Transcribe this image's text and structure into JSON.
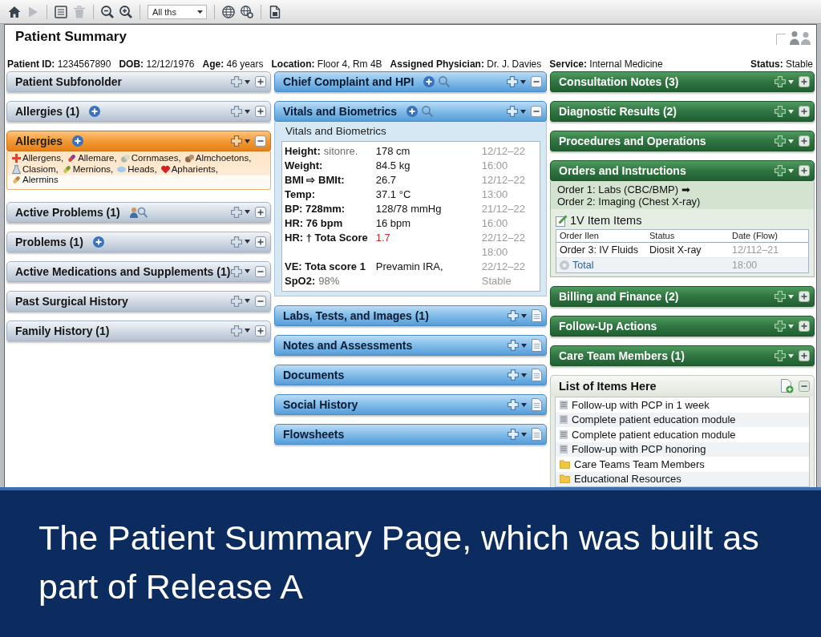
{
  "toolbar": {
    "buttons": [
      {
        "disabled": false
      },
      {
        "disabled": true
      },
      {
        "disabled": false
      },
      {
        "disabled": true
      },
      {
        "disabled": false
      },
      {
        "disabled": false
      }
    ],
    "filter": {
      "value": "All ths"
    },
    "more_buttons": [
      {
        "disabled": false
      },
      {
        "disabled": false
      },
      {
        "disabled": false
      }
    ]
  },
  "window": {
    "title": "Patient Summary"
  },
  "patient": {
    "fields": [
      {
        "label": "Patient ID:",
        "value": "1234567890"
      },
      {
        "label": "DOB:",
        "value": "12/12/1976"
      },
      {
        "label": "Age:",
        "value": "46 years"
      },
      {
        "label": "Location:",
        "value": "Floor 4, Rm 4B"
      },
      {
        "label": "Assigned Physician:",
        "value": "Dr. J. Davies"
      },
      {
        "label": "Service:",
        "value": "Internal Medicine"
      }
    ],
    "status": {
      "label": "Status:",
      "value": "Stable"
    }
  },
  "columns": [
    {
      "panels": [
        {
          "kind": "bar",
          "title": "Patient Subfonolder",
          "selected": false,
          "expanded": false
        },
        {
          "kind": "bar",
          "title": "Allergies (1)",
          "selected": false,
          "expanded": false,
          "header_icons": [
            {
              "kind": "add"
            }
          ]
        },
        {
          "kind": "allergies",
          "title": "Allergies",
          "selected": true,
          "expanded": true,
          "header_icons": [
            {
              "kind": "add"
            }
          ],
          "items": [
            "Allergens,",
            "Allemare,",
            "Cornmases,",
            "Almchoetons,",
            "Clasiom,",
            "Mernions,",
            "Heads,",
            "Apharients,",
            "Alermins"
          ]
        },
        {
          "kind": "bar",
          "title": "Active Problems (1)",
          "selected": false,
          "expanded": false,
          "header_icons": [
            {
              "kind": "people_search"
            }
          ]
        },
        {
          "kind": "bar",
          "title": "Problems (1)",
          "selected": false,
          "expanded": false,
          "header_icons": [
            {
              "kind": "add"
            }
          ]
        },
        {
          "kind": "bar",
          "title": "Active Medications and Supplements (1)",
          "selected": false,
          "expanded": true
        },
        {
          "kind": "bar",
          "title": "Past Surgical History",
          "selected": false,
          "expanded": true
        },
        {
          "kind": "bar",
          "title": "Family History (1)",
          "selected": false,
          "expanded": false
        }
      ]
    },
    {
      "panels": [
        {
          "kind": "bar",
          "title": "Chief Complaint and HPI",
          "selected": false,
          "expanded": true,
          "header_icons": [
            {
              "kind": "add"
            },
            {
              "kind": "search"
            }
          ]
        },
        {
          "kind": "vitals",
          "title": "Vitals and Biometrics",
          "selected": false,
          "expanded": true,
          "header_icons": [
            {
              "kind": "add"
            },
            {
              "kind": "search"
            }
          ],
          "subtitle": "Vitals and Biometrics",
          "rows": [
            {
              "label": "Height:",
              "note": "sitonre.",
              "value": "178 cm",
              "time": "12/12–22",
              "flagged": false
            },
            {
              "label": "Weight:",
              "value": "84.5 kg",
              "time": "16:00",
              "flagged": false
            },
            {
              "label": "BMI ⇨ BMIt:",
              "value": "26.7",
              "time": "12/12–22",
              "flagged": false
            },
            {
              "label": "Temp:",
              "value": "37.1 °C",
              "time": "13:00",
              "flagged": false
            },
            {
              "label": "BP: 728mm:",
              "value": "128/78 mmHg",
              "time": "21/12–22",
              "flagged": false
            },
            {
              "label": "HR: 76 bpm",
              "value": "16 bpm",
              "time": "16:00",
              "flagged": false
            },
            {
              "label": "HR: † Tota Score",
              "value": "1.7",
              "time": "22/12–22",
              "flagged": true
            },
            {
              "time": "18:00"
            },
            {
              "label": "VE: Tota score 1",
              "value": "Prevamin IRA,",
              "time": "22/12–22",
              "flagged": false
            },
            {
              "label": "SpO2:",
              "note": "98%",
              "time": "Stable"
            }
          ]
        },
        {
          "kind": "page_bar",
          "title": "Labs, Tests, and Images (1)",
          "selected": false
        },
        {
          "kind": "page_bar",
          "title": "Notes and Assessments",
          "selected": false
        },
        {
          "kind": "page_bar",
          "title": "Documents",
          "selected": false
        },
        {
          "kind": "page_bar",
          "title": "Social History",
          "selected": false
        },
        {
          "kind": "page_bar",
          "title": "Flowsheets",
          "selected": false
        }
      ]
    },
    {
      "panels": [
        {
          "kind": "bar",
          "title": "Consultation Notes (3)",
          "selected": false,
          "expanded": false
        },
        {
          "kind": "bar",
          "title": "Diagnostic Results (2)",
          "selected": false,
          "expanded": false
        },
        {
          "kind": "bar",
          "title": "Procedures and Operations",
          "selected": false,
          "expanded": false
        },
        {
          "kind": "orders",
          "title": "Orders and Instructions",
          "selected": false,
          "expanded": false,
          "orders": [
            "Order 1: Labs (CBC/BMP) ➡",
            "Order 2: Imaging (Chest X-ray)"
          ],
          "section_title": "1V Item Items",
          "table": {
            "columns": [
              "Order Ilen",
              "Status",
              "Date (Flow)"
            ],
            "rows": [
              {
                "kind": "order",
                "item": "Order 3: IV Fluids",
                "status": "Diosit X-ray",
                "date": "12/112–21"
              },
              {
                "kind": "total",
                "item": "Total",
                "date": "18:00"
              }
            ]
          }
        },
        {
          "kind": "bar",
          "title": "Billing and Finance (2)",
          "selected": false,
          "expanded": false
        },
        {
          "kind": "bar",
          "title": "Follow-Up Actions",
          "selected": false,
          "expanded": false
        },
        {
          "kind": "bar",
          "title": "Care Team Members (1)",
          "selected": false,
          "expanded": false
        },
        {
          "kind": "list",
          "title": "List of Items Here",
          "selected": false,
          "expanded": true,
          "items": [
            {
              "kind": "note",
              "text": "Follow-up with PCP in 1 week"
            },
            {
              "kind": "note",
              "text": "Complete patient education module"
            },
            {
              "kind": "note",
              "text": "Complete patient education module"
            },
            {
              "kind": "note",
              "text": "Follow-up with PCP honoring"
            },
            {
              "kind": "folder",
              "text": "Care Teams Team Members"
            },
            {
              "kind": "folder",
              "text": "Educational Resources"
            }
          ]
        }
      ]
    }
  ],
  "caption": "The Patient Summary Page, which was built as part of Release A"
}
